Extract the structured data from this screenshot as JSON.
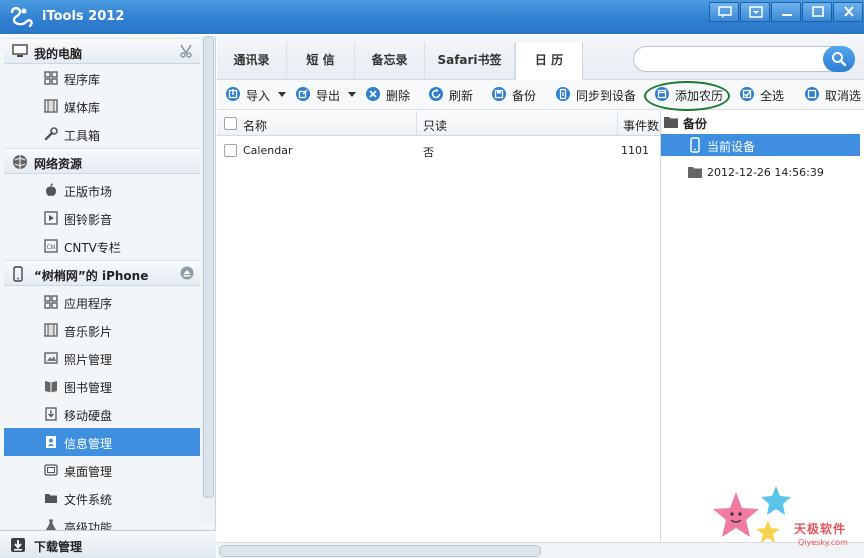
{
  "app": {
    "title": "iTools 2012"
  },
  "sidebar": {
    "sections": [
      {
        "title": "我的电脑",
        "items": [
          {
            "label": "程序库",
            "icon": "grid-icon"
          },
          {
            "label": "媒体库",
            "icon": "film-icon"
          },
          {
            "label": "工具箱",
            "icon": "wrench-icon"
          }
        ]
      },
      {
        "title": "网络资源",
        "items": [
          {
            "label": "正版市场",
            "icon": "apple-icon"
          },
          {
            "label": "图铃影音",
            "icon": "media-icon"
          },
          {
            "label": "CNTV专栏",
            "icon": "cntv-icon"
          }
        ]
      },
      {
        "title": "“树梢网”的 iPhone",
        "items": [
          {
            "label": "应用程序",
            "icon": "grid-icon"
          },
          {
            "label": "音乐影片",
            "icon": "film-icon"
          },
          {
            "label": "照片管理",
            "icon": "photo-icon"
          },
          {
            "label": "图书管理",
            "icon": "book-icon"
          },
          {
            "label": "移动硬盘",
            "icon": "disk-icon"
          },
          {
            "label": "信息管理",
            "icon": "contacts-icon",
            "active": true
          },
          {
            "label": "桌面管理",
            "icon": "desktop-icon"
          },
          {
            "label": "文件系统",
            "icon": "folder-icon"
          },
          {
            "label": "高级功能",
            "icon": "flask-icon"
          }
        ]
      }
    ],
    "bottom": {
      "label": "下载管理"
    }
  },
  "tabs": [
    {
      "label": "通讯录"
    },
    {
      "label": "短  信"
    },
    {
      "label": "备忘录"
    },
    {
      "label": "Safari书签"
    },
    {
      "label": "日  历",
      "active": true
    }
  ],
  "search": {
    "placeholder": "",
    "value": ""
  },
  "toolbar": {
    "import": "导入",
    "export": "导出",
    "delete": "删除",
    "refresh": "刷新",
    "backup": "备份",
    "sync": "同步到设备",
    "add_lunar": "添加农历",
    "select_all": "全选",
    "deselect": "取消选"
  },
  "table": {
    "columns": [
      "名称",
      "只读",
      "事件数"
    ],
    "rows": [
      {
        "name": "Calendar",
        "readonly": "否",
        "events": "1101"
      }
    ]
  },
  "backup_panel": {
    "title": "备份",
    "current": "当前设备",
    "entries": [
      "2012-12-26 14:56:39"
    ]
  },
  "watermark": {
    "text": "天极软件",
    "url": "Qiyesky.com"
  },
  "colors": {
    "titlebar": "#2f7fd0",
    "selection": "#3f8fe0",
    "highlight_ring": "#1e7a2e"
  }
}
